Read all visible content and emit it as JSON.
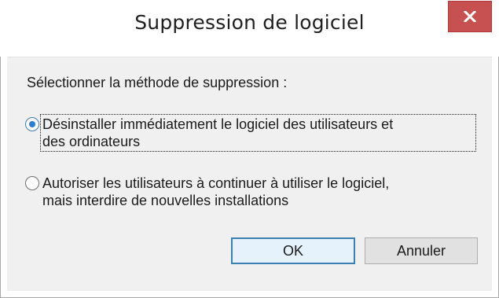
{
  "window": {
    "title": "Suppression de logiciel",
    "close_label": "×"
  },
  "dialog": {
    "prompt": "Sélectionner la méthode de suppression :",
    "options": [
      {
        "label_line1": "Désinstaller immédiatement le logiciel des utilisateurs et",
        "label_line2": "des ordinateurs",
        "selected": true
      },
      {
        "label_line1": "Autoriser les utilisateurs à continuer à utiliser le logiciel,",
        "label_line2": "mais interdire de nouvelles installations",
        "selected": false
      }
    ],
    "ok_label": "OK",
    "cancel_label": "Annuler"
  },
  "colors": {
    "close_button": "#c75050",
    "focus_accent": "#3c7fb1"
  }
}
